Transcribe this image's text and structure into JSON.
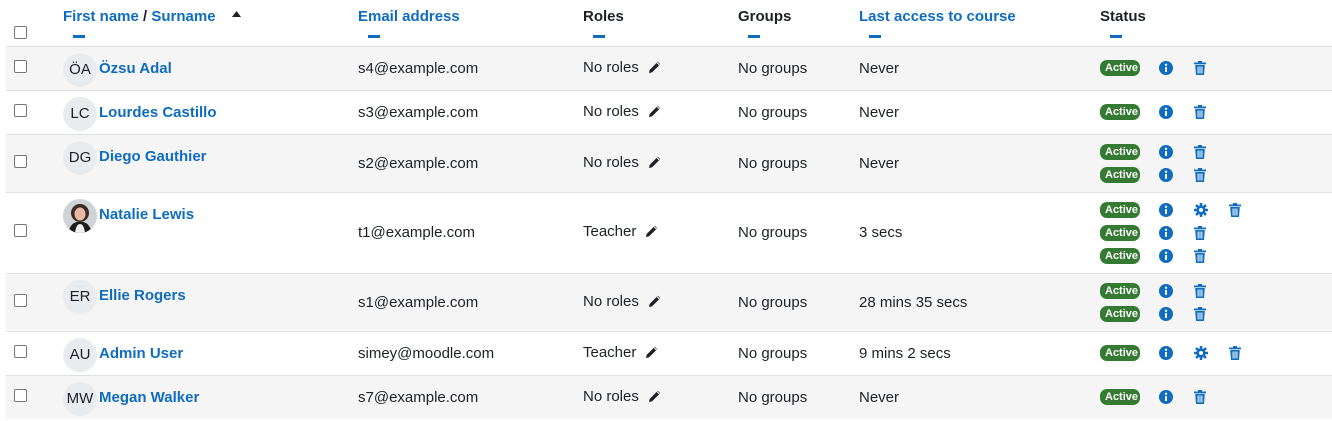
{
  "header": {
    "first_name": "First name",
    "separator": "/",
    "surname": "Surname",
    "email": "Email address",
    "roles": "Roles",
    "groups": "Groups",
    "last_access": "Last access to course",
    "status": "Status"
  },
  "icons": {
    "sort": "caret-up-icon",
    "edit": "pencil-icon",
    "info": "info-icon",
    "settings": "gear-icon",
    "delete": "trash-icon"
  },
  "colors": {
    "link": "#0f6cbf",
    "active_badge": "#357a32",
    "row_alt": "#f5f5f5"
  },
  "rows": [
    {
      "initials": "ÖA",
      "name": "Özsu Adal",
      "email": "s4@example.com",
      "roles": "No roles",
      "groups": "No groups",
      "access": "Never",
      "enrolments": [
        {
          "status": "Active",
          "settings": false
        }
      ]
    },
    {
      "initials": "LC",
      "name": "Lourdes Castillo",
      "email": "s3@example.com",
      "roles": "No roles",
      "groups": "No groups",
      "access": "Never",
      "enrolments": [
        {
          "status": "Active",
          "settings": false
        }
      ]
    },
    {
      "initials": "DG",
      "name": "Diego Gauthier",
      "email": "s2@example.com",
      "roles": "No roles",
      "groups": "No groups",
      "access": "Never",
      "enrolments": [
        {
          "status": "Active",
          "settings": false
        },
        {
          "status": "Active",
          "settings": false
        }
      ]
    },
    {
      "initials": "",
      "photo": true,
      "name": "Natalie Lewis",
      "email": "t1@example.com",
      "roles": "Teacher",
      "groups": "No groups",
      "access": "3 secs",
      "enrolments": [
        {
          "status": "Active",
          "settings": true
        },
        {
          "status": "Active",
          "settings": false
        },
        {
          "status": "Active",
          "settings": false
        }
      ]
    },
    {
      "initials": "ER",
      "name": "Ellie Rogers",
      "email": "s1@example.com",
      "roles": "No roles",
      "groups": "No groups",
      "access": "28 mins 35 secs",
      "enrolments": [
        {
          "status": "Active",
          "settings": false
        },
        {
          "status": "Active",
          "settings": false
        }
      ]
    },
    {
      "initials": "AU",
      "name": "Admin User",
      "email": "simey@moodle.com",
      "roles": "Teacher",
      "groups": "No groups",
      "access": "9 mins 2 secs",
      "enrolments": [
        {
          "status": "Active",
          "settings": true
        }
      ]
    },
    {
      "initials": "MW",
      "name": "Megan Walker",
      "email": "s7@example.com",
      "roles": "No roles",
      "groups": "No groups",
      "access": "Never",
      "enrolments": [
        {
          "status": "Active",
          "settings": false
        }
      ]
    }
  ]
}
